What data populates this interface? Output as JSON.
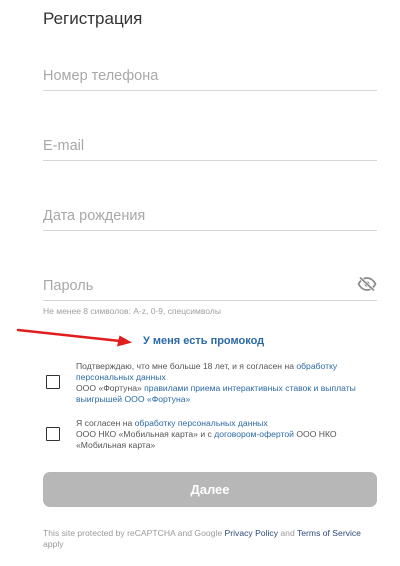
{
  "form": {
    "title": "Регистрация",
    "phone_placeholder": "Номер телефона",
    "email_placeholder": "E-mail",
    "birthdate_placeholder": "Дата рождения",
    "password_placeholder": "Пароль",
    "password_hint": "Не менее 8 символов: A-z, 0-9, спецсимволы",
    "promo_link": "У меня есть промокод",
    "submit_label": "Далее"
  },
  "consent1": {
    "text_prefix": "Подтверждаю, что мне больше 18 лет, и я согласен на ",
    "link_pd": "обработку персональных данных",
    "text_mid": "ООО «Фортуна» ",
    "link_rules": "правилами приема интерактивных ставок и выплаты выигрышей ООО «Фортуна»"
  },
  "consent2": {
    "text_prefix": "Я согласен на ",
    "link_pd": "обработку персональных данных",
    "text_mid": "ООО НКО «Мобильная карта» и с ",
    "link_offer": "договором-офертой",
    "text_suffix": " ООО НКО «Мобильная карта»"
  },
  "recaptcha": {
    "prefix": "This site protected by reCAPTCHA and Google ",
    "privacy": "Privacy Policy",
    "and": " and ",
    "terms": "Terms of Service",
    "suffix": " apply"
  },
  "icons": {
    "password_toggle": "eye-slash-icon",
    "annotation_arrow": "red-arrow-icon"
  },
  "colors": {
    "link": "#2b6aa6",
    "button": "#b7b7b7",
    "arrow": "#e11d1d"
  }
}
